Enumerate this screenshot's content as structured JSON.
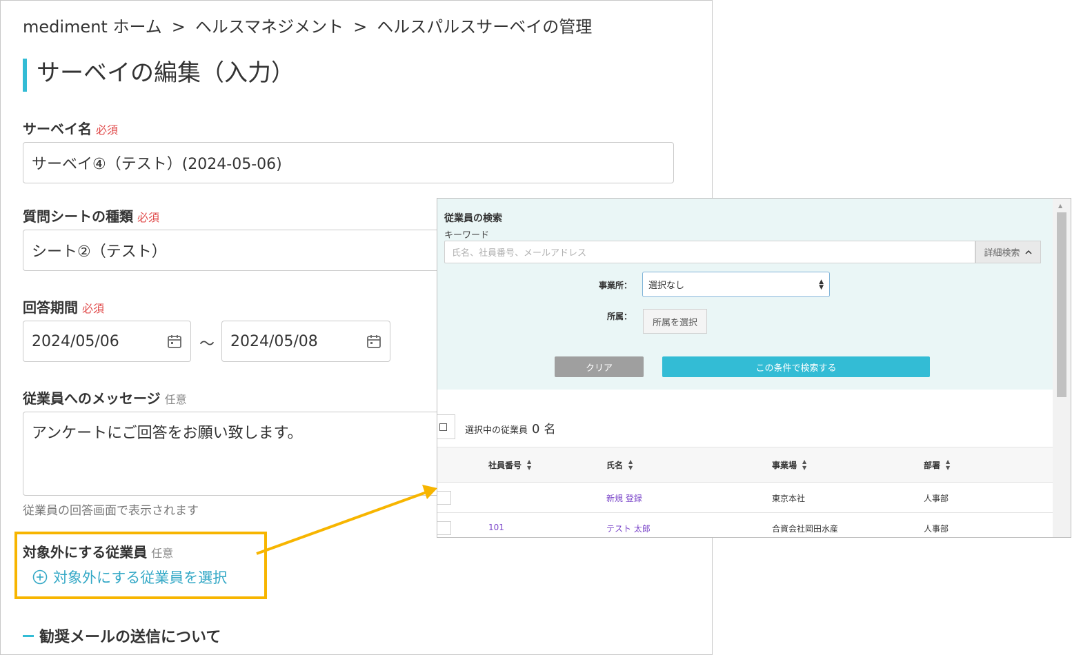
{
  "breadcrumb": {
    "items": [
      "mediment ホーム",
      "ヘルスマネジメント",
      "ヘルスパルスサーベイの管理"
    ],
    "separator": ">"
  },
  "page_title": "サーベイの編集（入力）",
  "form": {
    "survey_name": {
      "label": "サーベイ名",
      "badge": "必須",
      "value": "サーベイ④（テスト）(2024-05-06)"
    },
    "sheet_type": {
      "label": "質問シートの種類",
      "badge": "必須",
      "value": "シート②（テスト）"
    },
    "period": {
      "label": "回答期間",
      "badge": "必須",
      "start": "2024/05/06",
      "end": "2024/05/08",
      "separator": "～"
    },
    "message": {
      "label": "従業員へのメッセージ",
      "badge": "任意",
      "value": "アンケートにご回答をお願い致します。",
      "help": "従業員の回答画面で表示されます"
    },
    "excluded": {
      "label": "対象外にする従業員",
      "badge": "任意",
      "link": "対象外にする従業員を選択"
    },
    "section_heading": "勧奨メールの送信について"
  },
  "popup": {
    "title": "従業員の検索",
    "keyword_label": "キーワード",
    "keyword_placeholder": "氏名、社員番号、メールアドレス",
    "advanced_search": "詳細検索",
    "office_label": "事業所：",
    "office_value": "選択なし",
    "affiliation_label": "所属：",
    "affiliation_button": "所属を選択",
    "clear_button": "クリア",
    "search_button": "この条件で検索する",
    "selected_label": "選択中の従業員",
    "selected_count": "0",
    "selected_unit": "名",
    "table": {
      "headers": [
        "社員番号",
        "氏名",
        "事業場",
        "部署"
      ],
      "rows": [
        {
          "id": "",
          "name": "新規 登録",
          "site": "東京本社",
          "dept": "人事部"
        },
        {
          "id": "101",
          "name": "テスト 太郎",
          "site": "合資会社岡田水産",
          "dept": "人事部"
        }
      ]
    }
  },
  "colors": {
    "accent": "#33bcd5",
    "required": "#e04a4a",
    "highlight": "#f7b500",
    "link": "#7a45c9"
  }
}
